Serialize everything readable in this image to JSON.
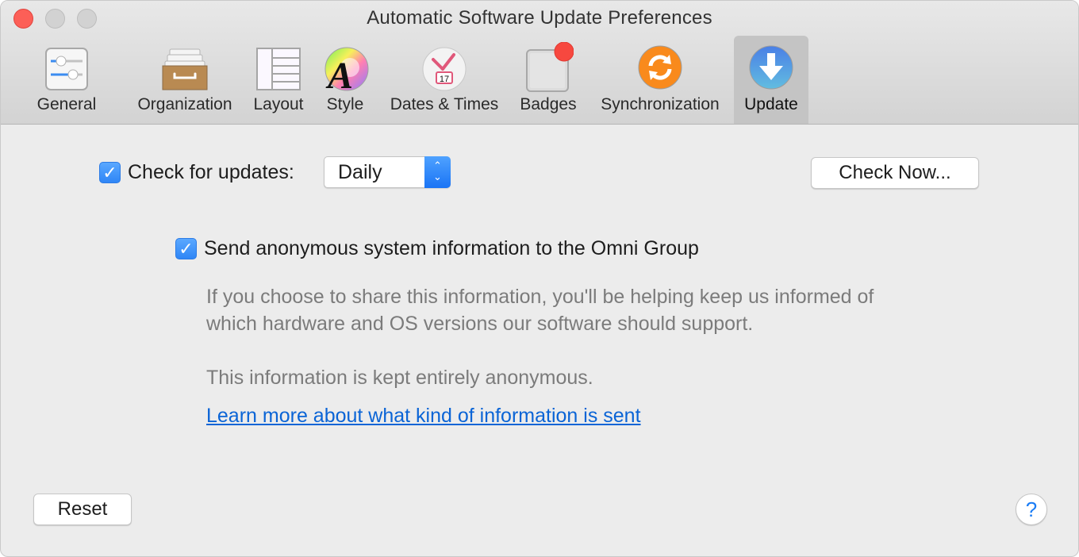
{
  "window": {
    "title": "Automatic Software Update Preferences",
    "traffic_lights": [
      "close",
      "minimize",
      "zoom"
    ]
  },
  "toolbar": {
    "items": [
      {
        "label": "General",
        "icon": "sliders-icon",
        "selected": false
      },
      {
        "label": "Organization",
        "icon": "file-drawer-icon",
        "selected": false
      },
      {
        "label": "Layout",
        "icon": "layout-columns-icon",
        "selected": false
      },
      {
        "label": "Style",
        "icon": "color-wheel-font-icon",
        "selected": false
      },
      {
        "label": "Dates & Times",
        "icon": "clock-calendar-icon",
        "selected": false,
        "calendar_day": "17"
      },
      {
        "label": "Badges",
        "icon": "badge-icon",
        "selected": false
      },
      {
        "label": "Synchronization",
        "icon": "sync-icon",
        "selected": false
      },
      {
        "label": "Update",
        "icon": "download-arrow-icon",
        "selected": true
      }
    ]
  },
  "updates": {
    "check_label": "Check for updates:",
    "check_checked": true,
    "frequency_value": "Daily",
    "check_now_label": "Check Now..."
  },
  "anonymous": {
    "send_label": "Send anonymous system information to the Omni Group",
    "send_checked": true,
    "desc_line1": "If you choose to share this information, you'll be helping keep us informed of",
    "desc_line2": "which hardware and OS versions our software should support.",
    "desc_line3": "This information is kept entirely anonymous.",
    "learn_more_link": "Learn more about what kind of information is sent"
  },
  "footer": {
    "reset_label": "Reset",
    "help_label": "?"
  },
  "colors": {
    "accent": "#2f86f6",
    "link": "#0a64d6",
    "close_button": "#fc5f57",
    "badge_red": "#f7483f",
    "sync_orange": "#f98a1c"
  }
}
